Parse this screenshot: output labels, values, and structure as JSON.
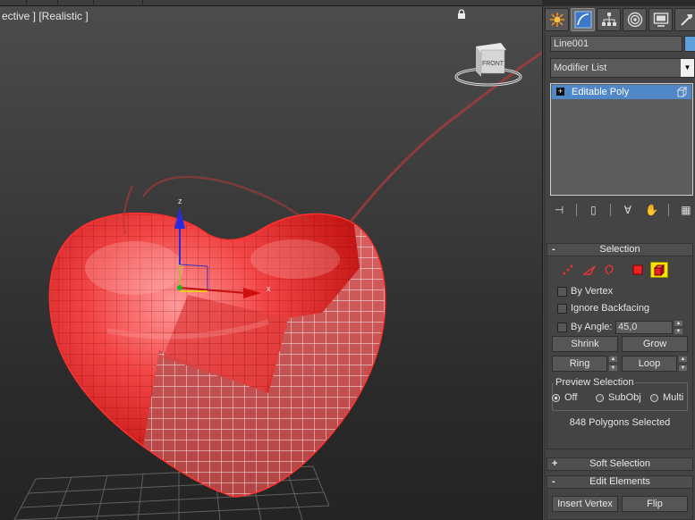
{
  "viewport": {
    "label": "ective ] [Realistic ]",
    "viewcube_face": "FRONT",
    "gizmo_axis_label": "z"
  },
  "panel": {
    "tabs": [
      {
        "icon": "create-icon"
      },
      {
        "icon": "modify-icon",
        "active": true
      },
      {
        "icon": "hierarchy-icon"
      },
      {
        "icon": "motion-icon"
      },
      {
        "icon": "display-icon"
      },
      {
        "icon": "utilities-icon"
      }
    ],
    "object_name": "Line001",
    "object_color": "#5e9fde",
    "modifier_list": "Modifier List",
    "stack_item": "Editable Poly"
  },
  "selection": {
    "title": "Selection",
    "by_vertex": "By Vertex",
    "ignore_backfacing": "Ignore Backfacing",
    "by_angle": "By Angle:",
    "angle_value": "45,0",
    "shrink": "Shrink",
    "grow": "Grow",
    "ring": "Ring",
    "loop": "Loop",
    "preview_title": "Preview Selection",
    "preview_off": "Off",
    "preview_subobj": "SubObj",
    "preview_multi": "Multi",
    "status": "848 Polygons Selected"
  },
  "soft_selection": {
    "title": "Soft Selection"
  },
  "edit_elements": {
    "title": "Edit Elements",
    "insert_vertex": "Insert Vertex",
    "flip": "Flip"
  }
}
